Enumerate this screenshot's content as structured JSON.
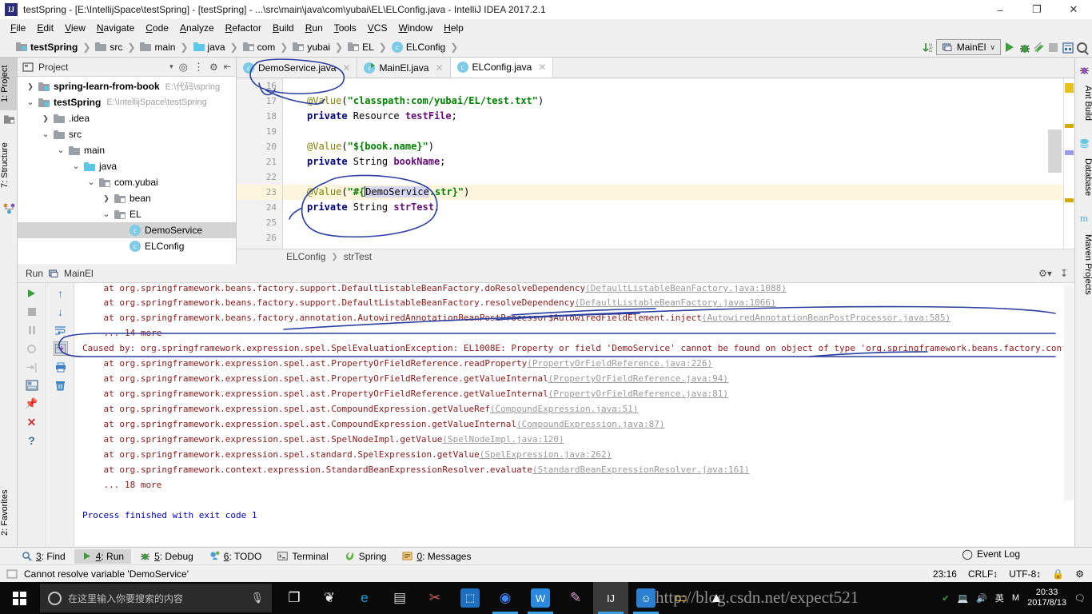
{
  "window": {
    "title": "testSpring - [E:\\IntellijSpace\\testSpring] - [testSpring] - ...\\src\\main\\java\\com\\yubai\\EL\\ELConfig.java - IntelliJ IDEA 2017.2.1",
    "app_icon": "IJ",
    "minimize_label": "–",
    "maximize_label": "❐",
    "close_label": "✕"
  },
  "menu": {
    "items": [
      "File",
      "Edit",
      "View",
      "Navigate",
      "Code",
      "Analyze",
      "Refactor",
      "Build",
      "Run",
      "Tools",
      "VCS",
      "Window",
      "Help"
    ]
  },
  "breadcrumb": {
    "items": [
      {
        "label": "testSpring",
        "icon": "module-folder-icon",
        "bold": true
      },
      {
        "label": "src",
        "icon": "folder-icon",
        "bold": false
      },
      {
        "label": "main",
        "icon": "folder-icon",
        "bold": false
      },
      {
        "label": "java",
        "icon": "source-folder-icon",
        "bold": false
      },
      {
        "label": "com",
        "icon": "package-icon",
        "bold": false
      },
      {
        "label": "yubai",
        "icon": "package-icon",
        "bold": false
      },
      {
        "label": "EL",
        "icon": "package-icon",
        "bold": false
      },
      {
        "label": "ELConfig",
        "icon": "class-icon",
        "bold": false
      }
    ],
    "separator": "❯"
  },
  "toolbar": {
    "compile_icon": "compile-icon",
    "run_config": "MainEl",
    "dropdown_caret": "∨",
    "run_icon": "run-icon",
    "debug_icon": "debug-icon",
    "coverage_icon": "run-with-coverage-icon",
    "stop_icon": "stop-icon",
    "layout_icon": "project-structure-icon",
    "search_icon": "search-everywhere-icon"
  },
  "left_tool_strip": {
    "tabs": [
      {
        "label": "1: Project",
        "selected": true
      },
      {
        "label": "7: Structure",
        "selected": false
      },
      {
        "label": "2: Favorites",
        "selected": false
      }
    ]
  },
  "right_tool_strip": {
    "tabs": [
      "Ant Build",
      "Database",
      "Maven Projects"
    ]
  },
  "project_panel": {
    "title": "Project",
    "dropdown_caret": "▾",
    "tool_icons": [
      "locate-icon",
      "collapse-all-icon",
      "settings-icon",
      "hide-icon"
    ],
    "tree": [
      {
        "indent": 0,
        "arrow": "❯",
        "icon": "module-folder-icon",
        "label": "spring-learn-from-book",
        "bold": true,
        "path": "E:\\代码\\spring",
        "selected": false
      },
      {
        "indent": 0,
        "arrow": "⌄",
        "icon": "module-folder-icon",
        "label": "testSpring",
        "bold": true,
        "path": "E:\\IntellijSpace\\testSpring",
        "selected": false
      },
      {
        "indent": 1,
        "arrow": "❯",
        "icon": "folder-icon",
        "label": ".idea",
        "bold": false,
        "path": "",
        "selected": false
      },
      {
        "indent": 1,
        "arrow": "⌄",
        "icon": "folder-icon",
        "label": "src",
        "bold": false,
        "path": "",
        "selected": false
      },
      {
        "indent": 2,
        "arrow": "⌄",
        "icon": "folder-icon",
        "label": "main",
        "bold": false,
        "path": "",
        "selected": false
      },
      {
        "indent": 3,
        "arrow": "⌄",
        "icon": "source-folder-icon",
        "label": "java",
        "bold": false,
        "path": "",
        "selected": false
      },
      {
        "indent": 4,
        "arrow": "⌄",
        "icon": "package-icon",
        "label": "com.yubai",
        "bold": false,
        "path": "",
        "selected": false
      },
      {
        "indent": 5,
        "arrow": "❯",
        "icon": "package-icon",
        "label": "bean",
        "bold": false,
        "path": "",
        "selected": false
      },
      {
        "indent": 5,
        "arrow": "⌄",
        "icon": "package-icon",
        "label": "EL",
        "bold": false,
        "path": "",
        "selected": false
      },
      {
        "indent": 6,
        "arrow": "",
        "icon": "class-icon",
        "label": "DemoService",
        "bold": false,
        "path": "",
        "selected": true
      },
      {
        "indent": 6,
        "arrow": "",
        "icon": "class-icon",
        "label": "ELConfig",
        "bold": false,
        "path": "",
        "selected": false
      }
    ]
  },
  "editor": {
    "tabs": [
      {
        "label": "DemoService.java",
        "icon": "class-icon",
        "active": false,
        "close": "✕",
        "modified": false
      },
      {
        "label": "MainEl.java",
        "icon": "runnable-class-icon",
        "active": false,
        "close": "✕",
        "modified": false
      },
      {
        "label": "ELConfig.java",
        "icon": "class-icon",
        "active": true,
        "close": "✕",
        "modified": false
      }
    ],
    "first_line_number": 16,
    "lines": [
      {
        "n": 16,
        "tokens": [],
        "highlight": false
      },
      {
        "n": 17,
        "tokens": [
          {
            "t": "@Value",
            "c": "ann"
          },
          {
            "t": "(",
            "c": "typ"
          },
          {
            "t": "\"classpath:com/yubai/EL/test.txt\"",
            "c": "str"
          },
          {
            "t": ")",
            "c": "typ"
          }
        ],
        "highlight": false
      },
      {
        "n": 18,
        "tokens": [
          {
            "t": "private ",
            "c": "kw"
          },
          {
            "t": "Resource ",
            "c": "typ"
          },
          {
            "t": "testFile",
            "c": "fld"
          },
          {
            "t": ";",
            "c": "typ"
          }
        ],
        "highlight": false
      },
      {
        "n": 19,
        "tokens": [],
        "highlight": false
      },
      {
        "n": 20,
        "tokens": [
          {
            "t": "@Value",
            "c": "ann"
          },
          {
            "t": "(",
            "c": "typ"
          },
          {
            "t": "\"${book.name}\"",
            "c": "str"
          },
          {
            "t": ")",
            "c": "typ"
          }
        ],
        "highlight": false
      },
      {
        "n": 21,
        "tokens": [
          {
            "t": "private ",
            "c": "kw"
          },
          {
            "t": "String ",
            "c": "typ"
          },
          {
            "t": "bookName",
            "c": "fld"
          },
          {
            "t": ";",
            "c": "typ"
          }
        ],
        "highlight": false
      },
      {
        "n": 22,
        "tokens": [],
        "highlight": false
      },
      {
        "n": 23,
        "tokens": [
          {
            "t": "@Value",
            "c": "ann"
          },
          {
            "t": "(",
            "c": "typ"
          },
          {
            "t": "\"#{",
            "c": "str"
          },
          {
            "t": "DemoService",
            "c": "sel"
          },
          {
            "t": ".str}\"",
            "c": "str"
          },
          {
            "t": ")",
            "c": "typ"
          }
        ],
        "highlight": true
      },
      {
        "n": 24,
        "tokens": [
          {
            "t": "private ",
            "c": "kw"
          },
          {
            "t": "String ",
            "c": "typ"
          },
          {
            "t": "strTest",
            "c": "fld"
          },
          {
            "t": ";",
            "c": "typ"
          }
        ],
        "highlight": false
      },
      {
        "n": 25,
        "tokens": [],
        "highlight": false
      },
      {
        "n": 26,
        "tokens": [],
        "highlight": false
      }
    ],
    "breadcrumb": [
      "ELConfig",
      "strTest"
    ],
    "breadcrumb_sep": "❯"
  },
  "run_panel": {
    "title": "Run",
    "config_name": "MainEl",
    "config_icon": "run-config-icon",
    "settings_icon": "settings-icon",
    "hide_icon": "hide-icon",
    "left_tools": [
      "rerun-icon",
      "stop-icon",
      "pause-icon",
      "dump-threads-icon",
      "exit-icon",
      "layout-icon",
      "pin-icon",
      "close-icon",
      "help-icon"
    ],
    "right_tools": [
      "scroll-up-icon",
      "scroll-down-icon",
      "soft-wrap-icon",
      "scroll-to-end-icon",
      "print-icon",
      "clear-all-icon"
    ],
    "console_lines": [
      {
        "text": "    at org.springframework.beans.factory.support.DefaultListableBeanFactory.doResolveDependency(DefaultListableBeanFactory.java:1088)",
        "type": "error",
        "clipped_top": true
      },
      {
        "text": "    at org.springframework.beans.factory.support.DefaultListableBeanFactory.resolveDependency(DefaultListableBeanFactory.java:1066)",
        "type": "error"
      },
      {
        "text": "    at org.springframework.beans.factory.annotation.AutowiredAnnotationBeanPostProcessor$AutowiredFieldElement.inject(AutowiredAnnotationBeanPostProcessor.java:585)",
        "type": "error"
      },
      {
        "text": "    ... 14 more",
        "type": "error"
      },
      {
        "text": "Caused by: org.springframework.expression.spel.SpelEvaluationException: EL1008E: Property or field 'DemoService' cannot be found on object of type 'org.springframework.beans.factory.config.BeanExpressionContext",
        "type": "error"
      },
      {
        "text": "    at org.springframework.expression.spel.ast.PropertyOrFieldReference.readProperty(PropertyOrFieldReference.java:226)",
        "type": "error"
      },
      {
        "text": "    at org.springframework.expression.spel.ast.PropertyOrFieldReference.getValueInternal(PropertyOrFieldReference.java:94)",
        "type": "error"
      },
      {
        "text": "    at org.springframework.expression.spel.ast.PropertyOrFieldReference.getValueInternal(PropertyOrFieldReference.java:81)",
        "type": "error"
      },
      {
        "text": "    at org.springframework.expression.spel.ast.CompoundExpression.getValueRef(CompoundExpression.java:51)",
        "type": "error"
      },
      {
        "text": "    at org.springframework.expression.spel.ast.CompoundExpression.getValueInternal(CompoundExpression.java:87)",
        "type": "error"
      },
      {
        "text": "    at org.springframework.expression.spel.ast.SpelNodeImpl.getValue(SpelNodeImpl.java:120)",
        "type": "error"
      },
      {
        "text": "    at org.springframework.expression.spel.standard.SpelExpression.getValue(SpelExpression.java:262)",
        "type": "error"
      },
      {
        "text": "    at org.springframework.context.expression.StandardBeanExpressionResolver.evaluate(StandardBeanExpressionResolver.java:161)",
        "type": "error"
      },
      {
        "text": "    ... 18 more",
        "type": "error"
      },
      {
        "text": "",
        "type": "error"
      },
      {
        "text": "Process finished with exit code 1",
        "type": "info"
      }
    ]
  },
  "bottom_tabs": {
    "items": [
      {
        "label": "3: Find",
        "icon": "find-icon",
        "selected": false
      },
      {
        "label": "4: Run",
        "icon": "run-icon",
        "selected": true
      },
      {
        "label": "5: Debug",
        "icon": "debug-icon",
        "selected": false
      },
      {
        "label": "6: TODO",
        "icon": "todo-icon",
        "selected": false
      },
      {
        "label": "Terminal",
        "icon": "terminal-icon",
        "selected": false
      },
      {
        "label": "Spring",
        "icon": "spring-icon",
        "selected": false
      },
      {
        "label": "0: Messages",
        "icon": "messages-icon",
        "selected": false
      }
    ],
    "event_log": "Event Log",
    "event_log_icon": "event-log-icon"
  },
  "statusbar": {
    "message": "Cannot resolve variable 'DemoService'",
    "message_icon": "info-icon",
    "position": "23:16",
    "line_separator": "CRLF↕",
    "encoding": "UTF-8↕",
    "lock_icon": "read-only-icon",
    "inspection_icon": "inspections-icon"
  },
  "taskbar": {
    "start_icon": "windows-start-icon",
    "search_placeholder": "在这里输入你要搜索的内容",
    "cortana_icon": "cortana-icon",
    "mic_icon": "microphone-icon",
    "apps": [
      {
        "name": "task-view-icon",
        "glyph": "❐",
        "active": false,
        "open": false,
        "color": "#ffffff",
        "bg": "transparent"
      },
      {
        "name": "sogou-icon",
        "glyph": "❦",
        "active": false,
        "open": false,
        "color": "#e8e8e8",
        "bg": "transparent"
      },
      {
        "name": "internet-explorer-icon",
        "glyph": "e",
        "active": false,
        "open": false,
        "color": "#1e9ada",
        "bg": "transparent"
      },
      {
        "name": "command-prompt-icon",
        "glyph": "▤",
        "active": false,
        "open": false,
        "color": "#cccccc",
        "bg": "transparent"
      },
      {
        "name": "snipping-tool-icon",
        "glyph": "✂",
        "active": false,
        "open": false,
        "color": "#d86060",
        "bg": "transparent"
      },
      {
        "name": "office-icon",
        "glyph": "⬚",
        "active": false,
        "open": false,
        "color": "#ffffff",
        "bg": "#1e6fbf"
      },
      {
        "name": "chrome-icon",
        "glyph": "◉",
        "active": false,
        "open": true,
        "color": "#4285f4",
        "bg": "transparent"
      },
      {
        "name": "wps-icon",
        "glyph": "W",
        "active": false,
        "open": true,
        "color": "#ffffff",
        "bg": "#2a8ae0"
      },
      {
        "name": "paint-icon",
        "glyph": "✎",
        "active": false,
        "open": false,
        "color": "#e0a0d0",
        "bg": "transparent"
      },
      {
        "name": "intellij-idea-icon",
        "glyph": "IJ",
        "active": true,
        "open": true,
        "color": "#ffffff",
        "bg": "#3a3a3a"
      },
      {
        "name": "qq-icon",
        "glyph": "☺",
        "active": false,
        "open": true,
        "color": "#ffffff",
        "bg": "#2a7fd0"
      },
      {
        "name": "file-explorer-icon",
        "glyph": "▭",
        "active": false,
        "open": false,
        "color": "#f0c040",
        "bg": "transparent"
      },
      {
        "name": "photos-icon",
        "glyph": "▲",
        "active": false,
        "open": false,
        "color": "#ffffff",
        "bg": "transparent"
      }
    ],
    "tray_icons": [
      "security-icon",
      "network-icon",
      "volume-icon",
      "ime-icon",
      "notification-icon"
    ],
    "ime_label": "英",
    "ime_label2": "M",
    "clock_time": "20:33",
    "clock_date": "2017/8/13"
  },
  "watermark": {
    "text": "http://blog.csdn.net/expect521"
  },
  "colors": {
    "accent_blue": "#3aa0e0",
    "error_red": "#8b1a1a",
    "info_blue": "#0000c0",
    "annotation_ink": "#2b3fa0",
    "highlight_line": "#fdf6dd",
    "selection": "#d7d7f5"
  }
}
